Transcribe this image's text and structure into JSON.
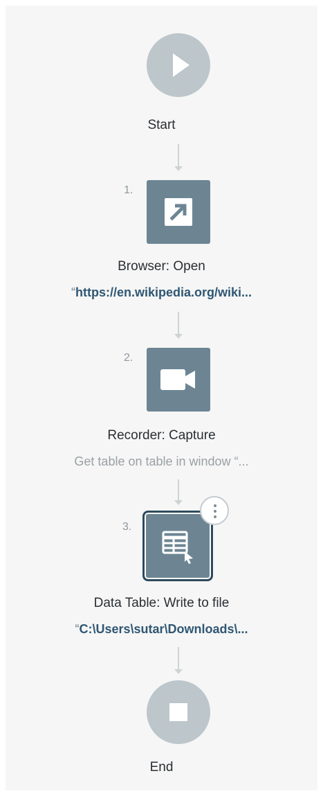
{
  "flow": {
    "start": {
      "label": "Start"
    },
    "end": {
      "label": "End"
    },
    "steps": [
      {
        "number": "1.",
        "title": "Browser: Open",
        "subtitle": "https://en.wikipedia.org/wiki...",
        "subtitle_quote": "“",
        "icon": "open-external-icon"
      },
      {
        "number": "2.",
        "title": "Recorder: Capture",
        "subtitle": "Get table on table in window “...",
        "icon": "video-camera-icon"
      },
      {
        "number": "3.",
        "title": "Data Table: Write to file",
        "subtitle": "C:\\Users\\sutar\\Downloads\\...",
        "subtitle_quote": "“",
        "icon": "data-table-write-icon",
        "selected": true
      }
    ]
  },
  "colors": {
    "panel_bg": "#f6f6f6",
    "terminal_circle": "#bcc6cb",
    "action_square": "#6d8593",
    "selected_border": "#2d4a5c",
    "link_text": "#2f5773",
    "muted_text": "#9aa0a4",
    "connector": "#cfd3d5"
  }
}
